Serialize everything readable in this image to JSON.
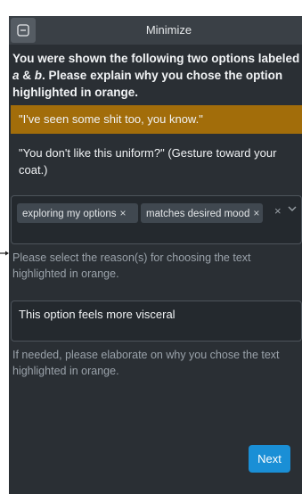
{
  "header": {
    "minimize_label": "Minimize",
    "minimize_icon": "minimize-icon"
  },
  "question": "You were shown the following two options labeled a & b. Please explain why you chose the option highlighted in orange.",
  "options": [
    {
      "text": "\"I've seen some shit too, you know.\"",
      "highlighted": true
    },
    {
      "text": "\"You don't like this uniform?\" (Gesture toward your coat.)",
      "highlighted": false
    }
  ],
  "reasons": {
    "selected": [
      "exploring my options",
      "matches desired mood"
    ],
    "remove_icon": "×",
    "clear_icon": "×",
    "dropdown_icon": "chevron-down-icon",
    "hint": "Please select the reason(s) for choosing the text highlighted in orange."
  },
  "elaboration": {
    "value": "This option feels more visceral",
    "hint": "If needed, please elaborate on why you chose the text highlighted in orange."
  },
  "next_label": "Next",
  "colors": {
    "highlight": "#a26d0a",
    "panel_bg": "#2a2f34",
    "accent": "#1a8fd6"
  }
}
